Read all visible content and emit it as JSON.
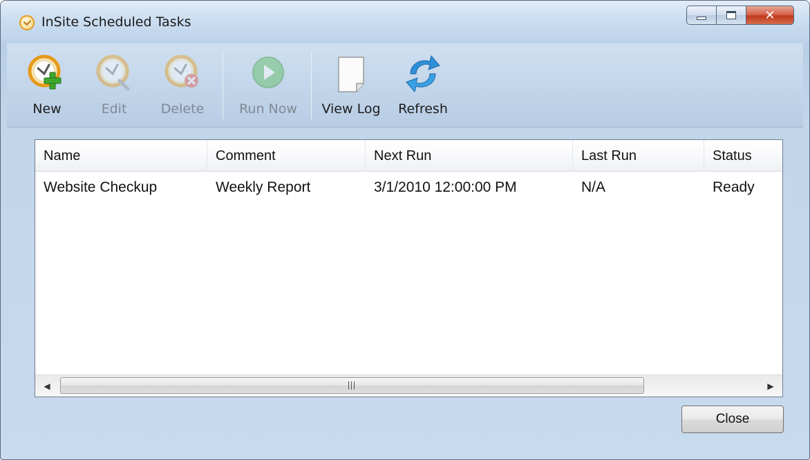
{
  "window": {
    "title": "InSite Scheduled Tasks"
  },
  "toolbar": {
    "new_label": "New",
    "edit_label": "Edit",
    "delete_label": "Delete",
    "run_now_label": "Run Now",
    "view_log_label": "View Log",
    "refresh_label": "Refresh"
  },
  "table": {
    "columns": [
      "Name",
      "Comment",
      "Next Run",
      "Last Run",
      "Status"
    ],
    "rows": [
      {
        "name": "Website Checkup",
        "comment": "Weekly Report",
        "next_run": "3/1/2010 12:00:00 PM",
        "last_run": "N/A",
        "status": "Ready"
      }
    ]
  },
  "buttons": {
    "close_label": "Close"
  },
  "icons": {
    "app": "clock-icon",
    "new": "clock-add-icon",
    "edit": "clock-edit-icon",
    "delete": "clock-delete-icon",
    "run_now": "play-icon",
    "view_log": "document-icon",
    "refresh": "refresh-icon"
  },
  "colors": {
    "accent_orange": "#e59b1c",
    "add_green": "#3ea82c",
    "refresh_blue": "#2f8fd6"
  }
}
